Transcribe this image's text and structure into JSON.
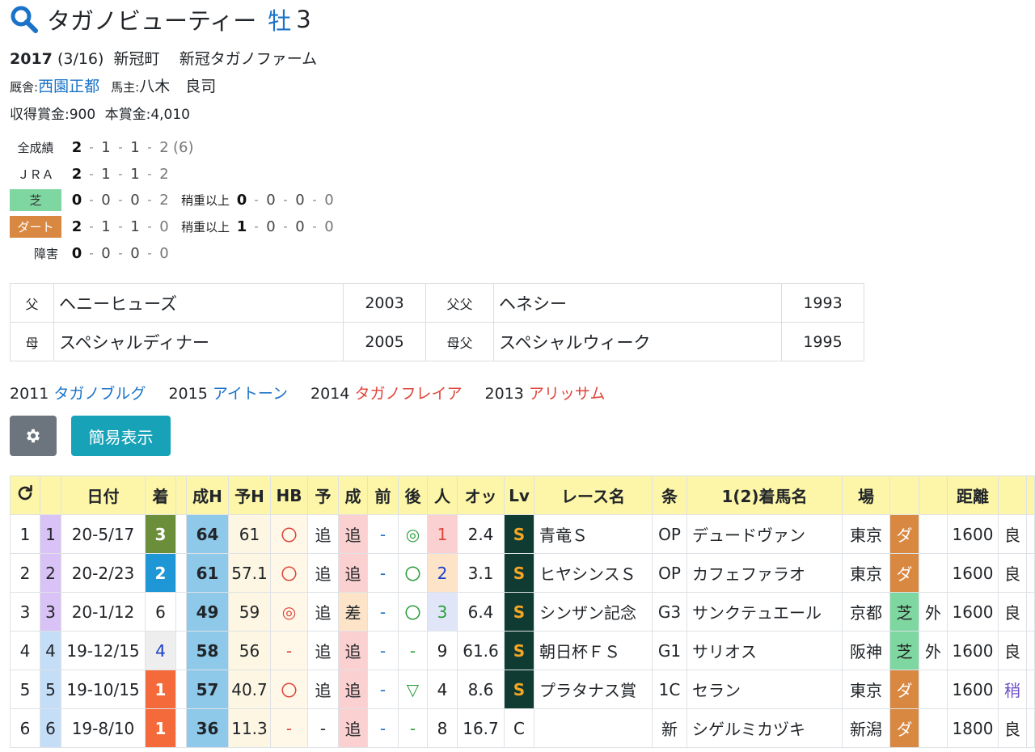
{
  "header": {
    "name": "タガノビューティー",
    "sex": "牡",
    "age": "3"
  },
  "birth": {
    "year": "2017",
    "date": "(3/16)",
    "place": "新冠町",
    "breeder": "新冠タガノファーム"
  },
  "stable": {
    "trainer_label": "厩舎:",
    "trainer": "西園正都",
    "owner_label": "馬主:",
    "owner": "八木　良司"
  },
  "prize": {
    "earned": "収得賞金:900",
    "main": "本賞金:4,010"
  },
  "records": [
    {
      "label": "全成績",
      "vals": [
        "2",
        "1",
        "1",
        "2"
      ],
      "extra": "(6)"
    },
    {
      "label": "ＪＲＡ",
      "vals": [
        "2",
        "1",
        "1",
        "2"
      ]
    },
    {
      "label": "芝",
      "vals": [
        "0",
        "0",
        "0",
        "2"
      ],
      "sub": "稍重以上",
      "sub_vals": [
        "0",
        "0",
        "0",
        "0"
      ]
    },
    {
      "label": "ダート",
      "vals": [
        "2",
        "1",
        "1",
        "0"
      ],
      "sub": "稍重以上",
      "sub_vals": [
        "1",
        "0",
        "0",
        "0"
      ]
    },
    {
      "label": "障害",
      "vals": [
        "0",
        "0",
        "0",
        "0"
      ]
    }
  ],
  "pedigree": {
    "sire_label": "父",
    "sire": "ヘニーヒューズ",
    "sire_year": "2003",
    "ss_label": "父父",
    "ss": "ヘネシー",
    "ss_year": "1993",
    "dam_label": "母",
    "dam": "スペシャルディナー",
    "dam_year": "2005",
    "ds_label": "母父",
    "ds": "スペシャルウィーク",
    "ds_year": "1995"
  },
  "siblings": [
    {
      "year": "2011",
      "name": "タガノブルグ",
      "sex": "m"
    },
    {
      "year": "2015",
      "name": "アイトーン",
      "sex": "m"
    },
    {
      "year": "2014",
      "name": "タガノフレイア",
      "sex": "f"
    },
    {
      "year": "2013",
      "name": "アリッサム",
      "sex": "f"
    }
  ],
  "buttons": {
    "simple": "簡易表示"
  },
  "table": {
    "headers": [
      "日付",
      "着",
      "成H",
      "予H",
      "HB",
      "予",
      "成",
      "前",
      "後",
      "人",
      "オッ",
      "Lv",
      "レース名",
      "条",
      "1(2)着馬名",
      "場",
      "距離"
    ],
    "rows": [
      {
        "i": "1",
        "n": "1",
        "date": "20-5/17",
        "rank": "3",
        "sh": "64",
        "yh": "61",
        "hb": "〇",
        "yo": "追",
        "sei": "追",
        "mae": "-",
        "ato": "◎",
        "pop": "1",
        "odds": "2.4",
        "lv": "S",
        "race": "青竜Ｓ",
        "cls": "OP",
        "winner": "デュードヴァン",
        "place": "東京",
        "surf": "ダ",
        "side": "",
        "dist": "1600",
        "cond": "良"
      },
      {
        "i": "2",
        "n": "2",
        "date": "20-2/23",
        "rank": "2",
        "sh": "61",
        "yh": "57.1",
        "hb": "〇",
        "yo": "追",
        "sei": "追",
        "mae": "-",
        "ato": "〇",
        "pop": "2",
        "odds": "3.1",
        "lv": "S",
        "race": "ヒヤシンスＳ",
        "cls": "OP",
        "winner": "カフェファラオ",
        "place": "東京",
        "surf": "ダ",
        "side": "",
        "dist": "1600",
        "cond": "良"
      },
      {
        "i": "3",
        "n": "3",
        "date": "20-1/12",
        "rank": "6",
        "sh": "49",
        "yh": "59",
        "hb": "◎",
        "yo": "追",
        "sei": "差",
        "mae": "-",
        "ato": "〇",
        "pop": "3",
        "odds": "6.4",
        "lv": "S",
        "race": "シンザン記念",
        "cls": "G3",
        "winner": "サンクテュエール",
        "place": "京都",
        "surf": "芝",
        "side": "外",
        "dist": "1600",
        "cond": "良"
      },
      {
        "i": "4",
        "n": "4",
        "date": "19-12/15",
        "rank": "4",
        "sh": "58",
        "yh": "56",
        "hb": "-",
        "yo": "追",
        "sei": "追",
        "mae": "-",
        "ato": "-",
        "pop": "9",
        "odds": "61.6",
        "lv": "S",
        "race": "朝日杯ＦＳ",
        "cls": "G1",
        "winner": "サリオス",
        "place": "阪神",
        "surf": "芝",
        "side": "外",
        "dist": "1600",
        "cond": "良"
      },
      {
        "i": "5",
        "n": "5",
        "date": "19-10/15",
        "rank": "1",
        "sh": "57",
        "yh": "40.7",
        "hb": "〇",
        "yo": "追",
        "sei": "追",
        "mae": "-",
        "ato": "▽",
        "pop": "4",
        "odds": "8.6",
        "lv": "S",
        "race": "プラタナス賞",
        "cls": "1C",
        "winner": "セラン",
        "place": "東京",
        "surf": "ダ",
        "side": "",
        "dist": "1600",
        "cond": "稍"
      },
      {
        "i": "6",
        "n": "6",
        "date": "19-8/10",
        "rank": "1",
        "sh": "36",
        "yh": "11.3",
        "hb": "-",
        "yo": "-",
        "sei": "追",
        "mae": "-",
        "ato": "-",
        "pop": "8",
        "odds": "16.7",
        "lv": "C",
        "race": "",
        "cls": "新",
        "winner": "シゲルミカヅキ",
        "place": "新潟",
        "surf": "ダ",
        "side": "",
        "dist": "1800",
        "cond": "良"
      }
    ]
  },
  "colors": {
    "accent": "#1a73c8",
    "turf": "#7ed6a0",
    "dirt": "#d98842",
    "header_bg": "#fdf6a8",
    "gear_btn": "#6c757d",
    "simple_btn": "#17a2b8"
  }
}
